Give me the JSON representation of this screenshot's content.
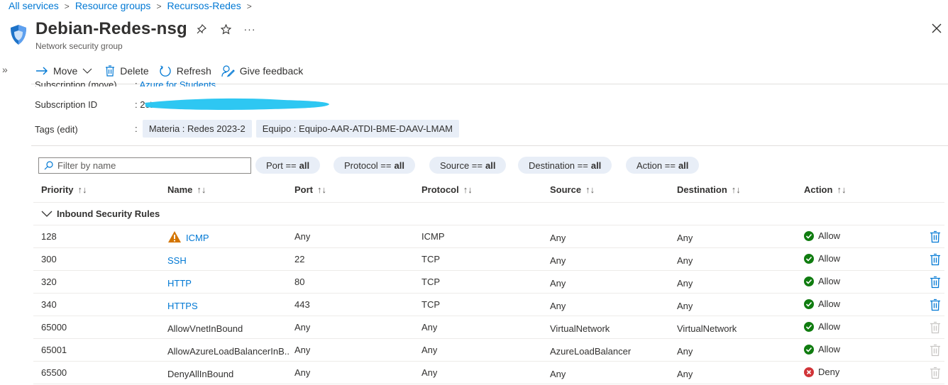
{
  "breadcrumb": [
    "All services",
    "Resource groups",
    "Recursos-Redes"
  ],
  "resource": {
    "name": "Debian-Redes-nsg",
    "type": "Network security group"
  },
  "toolbar": {
    "move": "Move",
    "delete": "Delete",
    "refresh": "Refresh",
    "feedback": "Give feedback"
  },
  "essentials": {
    "subscription_label": "Subscription (move)",
    "subscription_value": "Azure for Students",
    "subscription_id_label": "Subscription ID",
    "subscription_id_value": "2ct",
    "tags_label": "Tags (edit)",
    "tags": [
      "Materia : Redes 2023-2",
      "Equipo : Equipo-AAR-ATDI-BME-DAAV-LMAM"
    ]
  },
  "filter": {
    "placeholder": "Filter by name"
  },
  "pills": [
    {
      "label": "Port ==",
      "value": "all"
    },
    {
      "label": "Protocol ==",
      "value": "all"
    },
    {
      "label": "Source ==",
      "value": "all"
    },
    {
      "label": "Destination ==",
      "value": "all"
    },
    {
      "label": "Action ==",
      "value": "all"
    }
  ],
  "columns": [
    "Priority",
    "Name",
    "Port",
    "Protocol",
    "Source",
    "Destination",
    "Action"
  ],
  "group_label": "Inbound Security Rules",
  "rules": [
    {
      "priority": "128",
      "name": "ICMP",
      "port": "Any",
      "protocol": "ICMP",
      "source": "Any",
      "destination": "Any",
      "action": "Allow"
    },
    {
      "priority": "300",
      "name": "SSH",
      "port": "22",
      "protocol": "TCP",
      "source": "Any",
      "destination": "Any",
      "action": "Allow"
    },
    {
      "priority": "320",
      "name": "HTTP",
      "port": "80",
      "protocol": "TCP",
      "source": "Any",
      "destination": "Any",
      "action": "Allow"
    },
    {
      "priority": "340",
      "name": "HTTPS",
      "port": "443",
      "protocol": "TCP",
      "source": "Any",
      "destination": "Any",
      "action": "Allow"
    },
    {
      "priority": "65000",
      "name": "AllowVnetInBound",
      "port": "Any",
      "protocol": "Any",
      "source": "VirtualNetwork",
      "destination": "VirtualNetwork",
      "action": "Allow"
    },
    {
      "priority": "65001",
      "name": "AllowAzureLoadBalancerInB...",
      "port": "Any",
      "protocol": "Any",
      "source": "AzureLoadBalancer",
      "destination": "Any",
      "action": "Allow"
    },
    {
      "priority": "65500",
      "name": "DenyAllInBound",
      "port": "Any",
      "protocol": "Any",
      "source": "Any",
      "destination": "Any",
      "action": "Deny"
    }
  ],
  "colors": {
    "accent": "#0078d4",
    "allow": "#107c10",
    "deny": "#d13438",
    "warning": "#d47500",
    "pill": "#e8eef7"
  }
}
